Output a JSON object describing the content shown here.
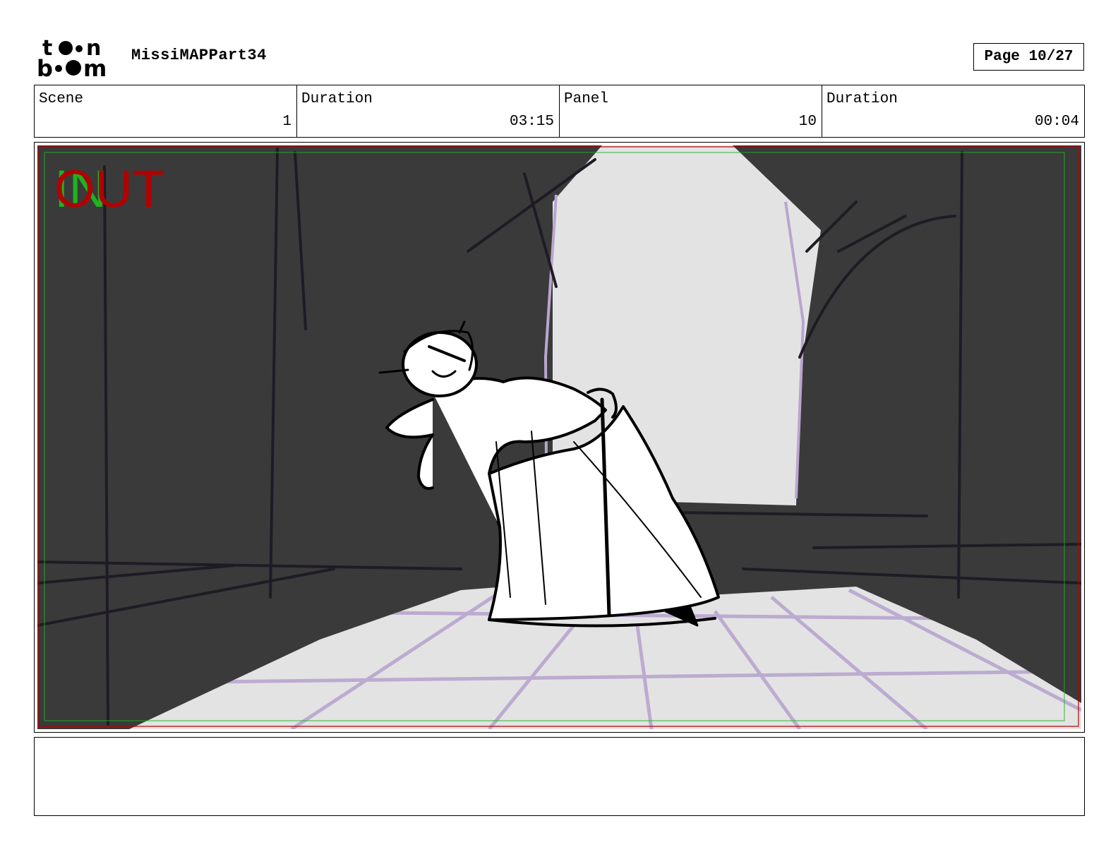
{
  "header": {
    "logo_text": "toon boom",
    "project_title": "MissiMAPPart34",
    "page_label": "Page 10/27"
  },
  "info": {
    "scene_label": "Scene",
    "scene_value": "1",
    "scene_duration_label": "Duration",
    "scene_duration_value": "03:15",
    "panel_label": "Panel",
    "panel_value": "10",
    "panel_duration_label": "Duration",
    "panel_duration_value": "00:04"
  },
  "panel": {
    "in_label": "IN",
    "out_label": "OUT",
    "colors": {
      "curtain": "#3a3a3a",
      "backdrop": "#e3e3e3",
      "floor_grid": "#b8a6cf",
      "in_marker": "#1fb31f",
      "out_marker": "#b30000"
    }
  },
  "notes": {
    "text": ""
  }
}
